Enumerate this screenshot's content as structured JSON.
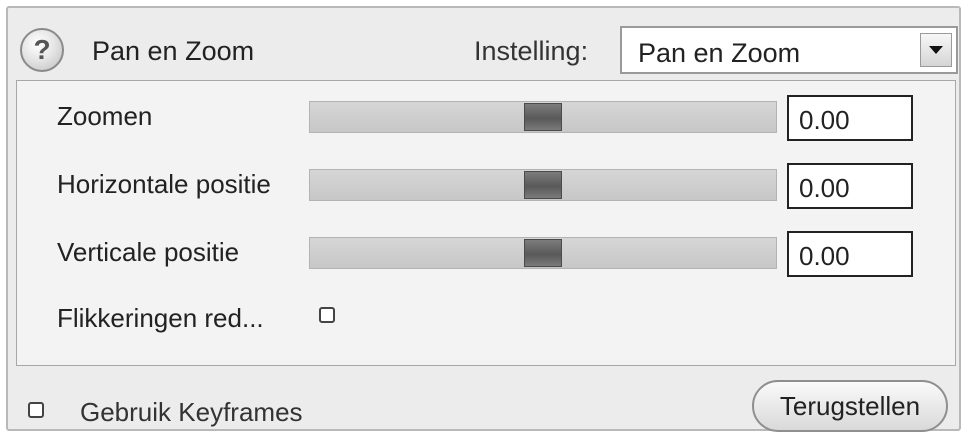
{
  "header": {
    "title": "Pan en Zoom",
    "preset_label": "Instelling:",
    "preset_value": "Pan en Zoom"
  },
  "controls": [
    {
      "label": "Zoomen",
      "value": "0.00",
      "slider_fraction": 0.5
    },
    {
      "label": "Horizontale positie",
      "value": "0.00",
      "slider_fraction": 0.5
    },
    {
      "label": "Verticale positie",
      "value": "0.00",
      "slider_fraction": 0.5
    }
  ],
  "flicker": {
    "label": "Flikkeringen red...",
    "checked": false
  },
  "footer": {
    "keyframes_label": "Gebruik Keyframes",
    "keyframes_checked": false,
    "reset_label": "Terugstellen"
  }
}
